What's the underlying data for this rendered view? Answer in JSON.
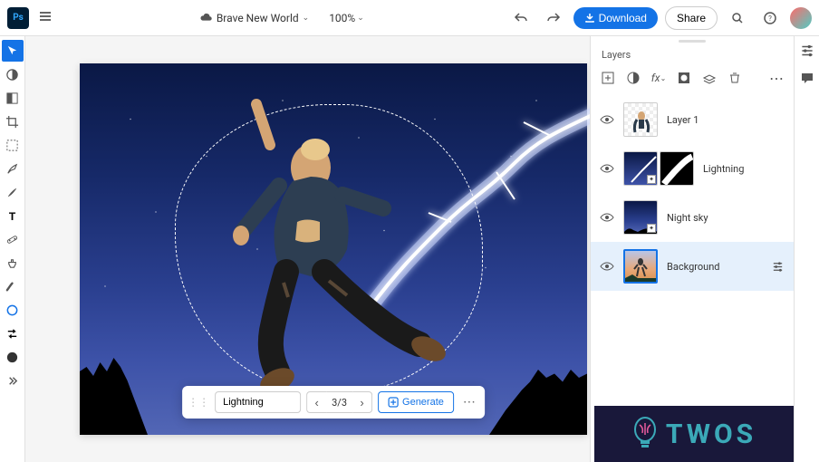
{
  "document": {
    "title": "Brave New World"
  },
  "zoom": {
    "value": "100%"
  },
  "topbar": {
    "download": "Download",
    "share": "Share"
  },
  "panels": {
    "layers_title": "Layers"
  },
  "generate": {
    "input_value": "Lightning",
    "counter": "3/3",
    "button_label": "Generate"
  },
  "layers": {
    "items": [
      {
        "name": "Layer 1"
      },
      {
        "name": "Lightning"
      },
      {
        "name": "Night sky"
      },
      {
        "name": "Background"
      }
    ]
  },
  "watermark": {
    "text": "TWOS"
  }
}
